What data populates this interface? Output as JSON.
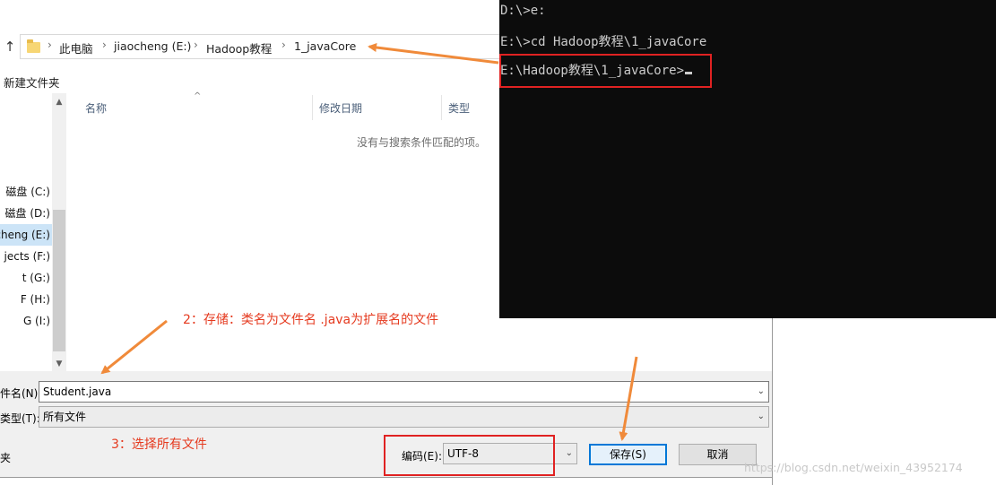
{
  "dialog": {
    "breadcrumb": [
      "此电脑",
      "jiaocheng (E:)",
      "Hadoop教程",
      "1_javaCore"
    ],
    "new_folder": "新建文件夹",
    "nav_items": [
      "磁盘 (C:)",
      "磁盘 (D:)",
      "cheng (E:)",
      "jects (F:)",
      "t (G:)",
      "F (H:)",
      "G (I:)"
    ],
    "columns": {
      "name": "名称",
      "modified": "修改日期",
      "type": "类型"
    },
    "empty_message": "没有与搜索条件匹配的项。",
    "filename_label": "件名(N):",
    "filename_value": "Student.java",
    "filetype_label": "类型(T):",
    "filetype_value": "所有文件",
    "hide_folders": "夹",
    "encoding_label": "编码(E):",
    "encoding_value": "UTF-8",
    "save_button": "保存(S)",
    "cancel_button": "取消"
  },
  "console": {
    "lines": [
      "D:\\>e:",
      "E:\\>cd Hadoop教程\\1_javaCore",
      "E:\\Hadoop教程\\1_javaCore>"
    ]
  },
  "annotations": {
    "note2": "2：存储：类名为文件名 .java为扩展名的文件",
    "note3": "3：选择所有文件",
    "accent_color": "#e53a1f",
    "arrow_color": "#f08a3a"
  },
  "watermark": "https://blog.csdn.net/weixin_43952174"
}
